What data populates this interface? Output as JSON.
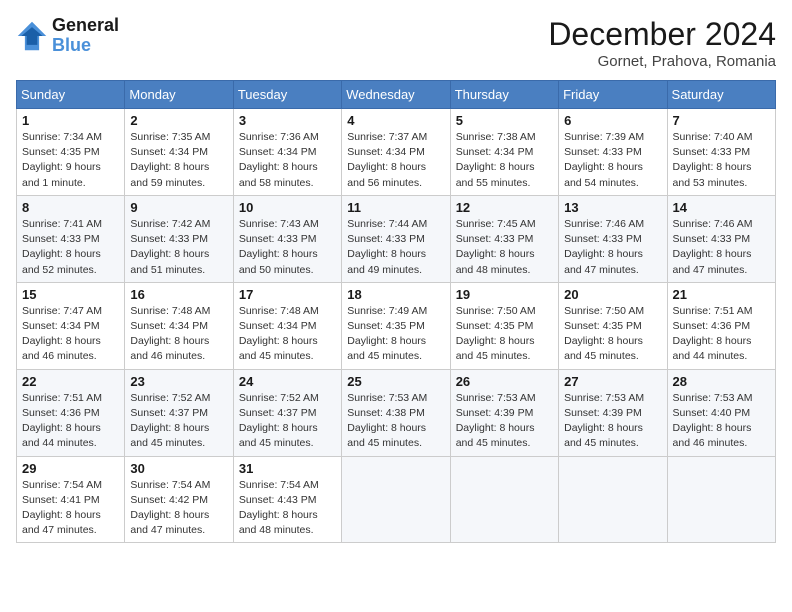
{
  "header": {
    "logo_line1": "General",
    "logo_line2": "Blue",
    "month": "December 2024",
    "location": "Gornet, Prahova, Romania"
  },
  "days_of_week": [
    "Sunday",
    "Monday",
    "Tuesday",
    "Wednesday",
    "Thursday",
    "Friday",
    "Saturday"
  ],
  "weeks": [
    [
      {
        "day": "1",
        "sunrise": "7:34 AM",
        "sunset": "4:35 PM",
        "daylight": "9 hours and 1 minute."
      },
      {
        "day": "2",
        "sunrise": "7:35 AM",
        "sunset": "4:34 PM",
        "daylight": "8 hours and 59 minutes."
      },
      {
        "day": "3",
        "sunrise": "7:36 AM",
        "sunset": "4:34 PM",
        "daylight": "8 hours and 58 minutes."
      },
      {
        "day": "4",
        "sunrise": "7:37 AM",
        "sunset": "4:34 PM",
        "daylight": "8 hours and 56 minutes."
      },
      {
        "day": "5",
        "sunrise": "7:38 AM",
        "sunset": "4:34 PM",
        "daylight": "8 hours and 55 minutes."
      },
      {
        "day": "6",
        "sunrise": "7:39 AM",
        "sunset": "4:33 PM",
        "daylight": "8 hours and 54 minutes."
      },
      {
        "day": "7",
        "sunrise": "7:40 AM",
        "sunset": "4:33 PM",
        "daylight": "8 hours and 53 minutes."
      }
    ],
    [
      {
        "day": "8",
        "sunrise": "7:41 AM",
        "sunset": "4:33 PM",
        "daylight": "8 hours and 52 minutes."
      },
      {
        "day": "9",
        "sunrise": "7:42 AM",
        "sunset": "4:33 PM",
        "daylight": "8 hours and 51 minutes."
      },
      {
        "day": "10",
        "sunrise": "7:43 AM",
        "sunset": "4:33 PM",
        "daylight": "8 hours and 50 minutes."
      },
      {
        "day": "11",
        "sunrise": "7:44 AM",
        "sunset": "4:33 PM",
        "daylight": "8 hours and 49 minutes."
      },
      {
        "day": "12",
        "sunrise": "7:45 AM",
        "sunset": "4:33 PM",
        "daylight": "8 hours and 48 minutes."
      },
      {
        "day": "13",
        "sunrise": "7:46 AM",
        "sunset": "4:33 PM",
        "daylight": "8 hours and 47 minutes."
      },
      {
        "day": "14",
        "sunrise": "7:46 AM",
        "sunset": "4:33 PM",
        "daylight": "8 hours and 47 minutes."
      }
    ],
    [
      {
        "day": "15",
        "sunrise": "7:47 AM",
        "sunset": "4:34 PM",
        "daylight": "8 hours and 46 minutes."
      },
      {
        "day": "16",
        "sunrise": "7:48 AM",
        "sunset": "4:34 PM",
        "daylight": "8 hours and 46 minutes."
      },
      {
        "day": "17",
        "sunrise": "7:48 AM",
        "sunset": "4:34 PM",
        "daylight": "8 hours and 45 minutes."
      },
      {
        "day": "18",
        "sunrise": "7:49 AM",
        "sunset": "4:35 PM",
        "daylight": "8 hours and 45 minutes."
      },
      {
        "day": "19",
        "sunrise": "7:50 AM",
        "sunset": "4:35 PM",
        "daylight": "8 hours and 45 minutes."
      },
      {
        "day": "20",
        "sunrise": "7:50 AM",
        "sunset": "4:35 PM",
        "daylight": "8 hours and 45 minutes."
      },
      {
        "day": "21",
        "sunrise": "7:51 AM",
        "sunset": "4:36 PM",
        "daylight": "8 hours and 44 minutes."
      }
    ],
    [
      {
        "day": "22",
        "sunrise": "7:51 AM",
        "sunset": "4:36 PM",
        "daylight": "8 hours and 44 minutes."
      },
      {
        "day": "23",
        "sunrise": "7:52 AM",
        "sunset": "4:37 PM",
        "daylight": "8 hours and 45 minutes."
      },
      {
        "day": "24",
        "sunrise": "7:52 AM",
        "sunset": "4:37 PM",
        "daylight": "8 hours and 45 minutes."
      },
      {
        "day": "25",
        "sunrise": "7:53 AM",
        "sunset": "4:38 PM",
        "daylight": "8 hours and 45 minutes."
      },
      {
        "day": "26",
        "sunrise": "7:53 AM",
        "sunset": "4:39 PM",
        "daylight": "8 hours and 45 minutes."
      },
      {
        "day": "27",
        "sunrise": "7:53 AM",
        "sunset": "4:39 PM",
        "daylight": "8 hours and 45 minutes."
      },
      {
        "day": "28",
        "sunrise": "7:53 AM",
        "sunset": "4:40 PM",
        "daylight": "8 hours and 46 minutes."
      }
    ],
    [
      {
        "day": "29",
        "sunrise": "7:54 AM",
        "sunset": "4:41 PM",
        "daylight": "8 hours and 47 minutes."
      },
      {
        "day": "30",
        "sunrise": "7:54 AM",
        "sunset": "4:42 PM",
        "daylight": "8 hours and 47 minutes."
      },
      {
        "day": "31",
        "sunrise": "7:54 AM",
        "sunset": "4:43 PM",
        "daylight": "8 hours and 48 minutes."
      },
      null,
      null,
      null,
      null
    ]
  ]
}
